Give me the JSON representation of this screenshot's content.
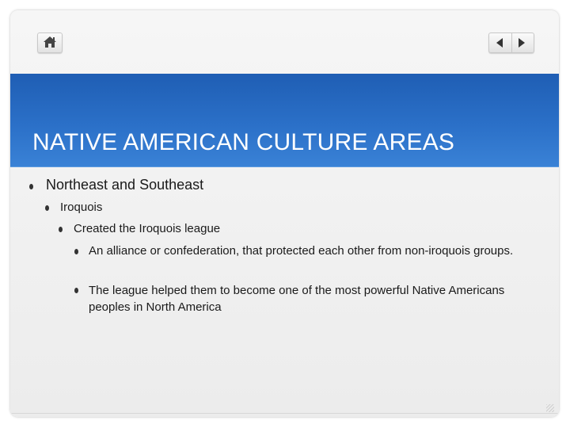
{
  "title": "NATIVE AMERICAN CULTURE AREAS",
  "bullets": {
    "b1": "Northeast and Southeast",
    "b2": "Iroquois",
    "b3": "Created the Iroquois league",
    "b4": "An alliance or confederation, that protected each other from non-iroquois groups.",
    "b5": "The league helped them to become one of the most powerful Native Americans peoples in North America"
  },
  "icons": {
    "home": "home-icon",
    "prev": "left-triangle-icon",
    "next": "right-triangle-icon"
  },
  "colors": {
    "title_band": "#2b6dc4",
    "title_text": "#ffffff",
    "background": "#f1f1f1"
  }
}
